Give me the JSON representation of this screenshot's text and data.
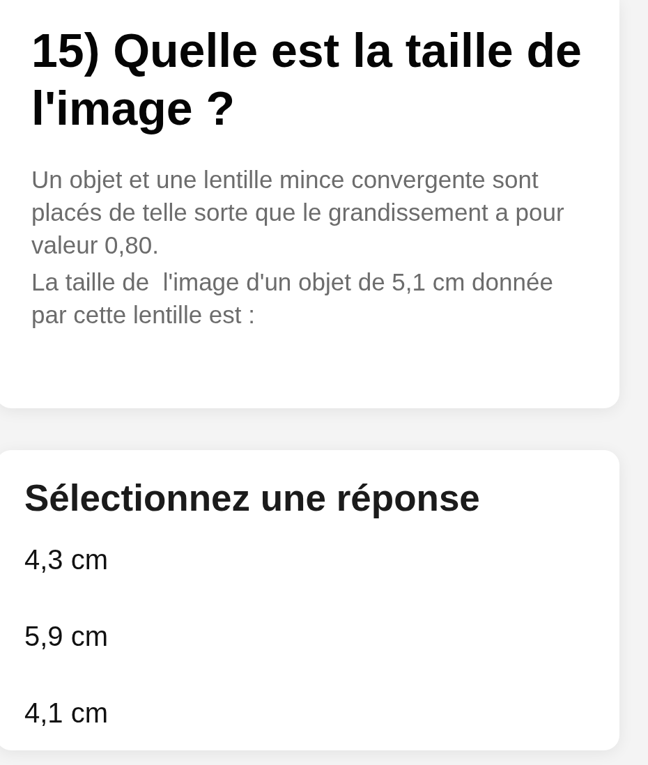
{
  "question": {
    "title": "15) Quelle est la taille de l'image ?",
    "paragraphs": [
      "Un objet et une lentille mince convergente sont placés de telle sorte que le grandissement a pour valeur 0,80.",
      "La taille de  l'image d'un objet de 5,1 cm donnée par cette lentille est :"
    ]
  },
  "answers": {
    "heading": "Sélectionnez une réponse",
    "options": [
      {
        "label": "4,3 cm",
        "selected": false
      },
      {
        "label": "5,9 cm",
        "selected": false
      },
      {
        "label": "4,1 cm",
        "selected": false
      }
    ]
  }
}
